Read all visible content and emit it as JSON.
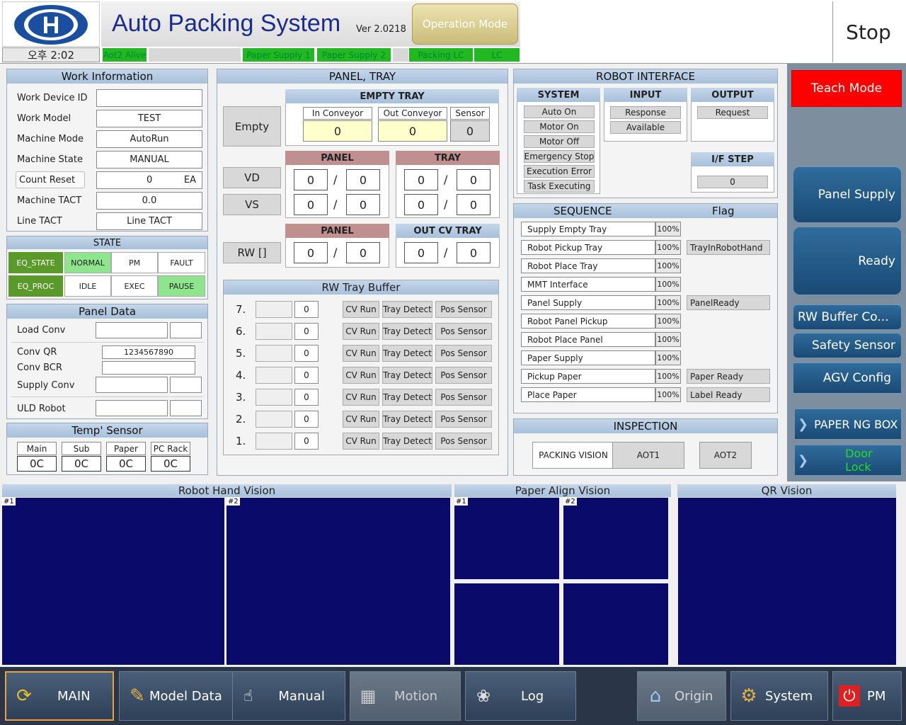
{
  "header": {
    "clock": "오후 2:02",
    "title": "Auto Packing System",
    "version": "Ver 2.0218",
    "operation_mode": "Operation Mode",
    "stop": "Stop",
    "status": [
      {
        "label": "Aot2 Alive"
      },
      {
        "label": ""
      },
      {
        "label": "Paper Supply 1"
      },
      {
        "label": "Paper Supply 2"
      },
      {
        "label": ""
      },
      {
        "label": "Packing LC"
      },
      {
        "label": "LC"
      }
    ]
  },
  "work_info": {
    "title": "Work Information",
    "rows": [
      {
        "label": "Work Device ID",
        "value": "",
        "unit": ""
      },
      {
        "label": "Work Model",
        "value": "TEST",
        "unit": ""
      },
      {
        "label": "Machine Mode",
        "value": "AutoRun",
        "unit": ""
      },
      {
        "label": "Machine State",
        "value": "MANUAL",
        "unit": ""
      },
      {
        "label": "Count Reset",
        "value": "0",
        "unit": "EA"
      },
      {
        "label": "Machine TACT",
        "value": "0.0",
        "unit": ""
      },
      {
        "label": "Line TACT",
        "value": "Line TACT",
        "unit": ""
      }
    ]
  },
  "state": {
    "title": "STATE",
    "eq_state": "EQ_STATE",
    "eq_proc": "EQ_PROC",
    "normal": "NORMAL",
    "pm": "PM",
    "fault": "FAULT",
    "idle": "IDLE",
    "exec": "EXEC",
    "pause": "PAUSE"
  },
  "panel_data": {
    "title": "Panel Data",
    "load_conv": "Load Conv",
    "conv_qr": "Conv QR",
    "conv_qr_value": "1234567890",
    "conv_bcr": "Conv BCR",
    "supply_conv": "Supply Conv",
    "uld_robot": "ULD Robot"
  },
  "temp": {
    "title": "Temp' Sensor",
    "items": [
      {
        "label": "Main",
        "value": "0C"
      },
      {
        "label": "Sub",
        "value": "0C"
      },
      {
        "label": "Paper",
        "value": "0C"
      },
      {
        "label": "PC Rack",
        "value": "0C"
      }
    ]
  },
  "panel_tray": {
    "title": "PANEL, TRAY",
    "empty_btn": "Empty",
    "empty_tray": "EMPTY TRAY",
    "in_conv": "In Conveyor",
    "out_conv": "Out Conveyor",
    "sensor": "Sensor",
    "in_val": "0",
    "out_val": "0",
    "sensor_val": "0",
    "panel": "PANEL",
    "tray": "TRAY",
    "out_cv_tray": "OUT CV TRAY",
    "vd": "VD",
    "vs": "VS",
    "rw": "RW []",
    "zero": "0",
    "slash": "/"
  },
  "rw_buffer": {
    "title": "RW Tray Buffer",
    "cv_run": "CV Run",
    "tray_detect": "Tray Detect",
    "pos_sensor": "Pos Sensor",
    "rows": [
      {
        "n": "7.",
        "v": "0"
      },
      {
        "n": "6.",
        "v": "0"
      },
      {
        "n": "5.",
        "v": "0"
      },
      {
        "n": "4.",
        "v": "0"
      },
      {
        "n": "3.",
        "v": "0"
      },
      {
        "n": "2.",
        "v": "0"
      },
      {
        "n": "1.",
        "v": "0"
      }
    ]
  },
  "robot_if": {
    "title": "ROBOT INTERFACE",
    "system": "SYSTEM",
    "input": "INPUT",
    "output": "OUTPUT",
    "system_items": [
      "Auto On",
      "Motor On",
      "Motor Off",
      "Emergency Stop",
      "Execution Error",
      "Task Executing"
    ],
    "input_items": [
      "Response",
      "Available"
    ],
    "output_items": [
      "Request"
    ],
    "if_step": "I/F STEP",
    "if_step_val": "0"
  },
  "sequence": {
    "title": "SEQUENCE",
    "flag": "Flag",
    "rows": [
      {
        "name": "Supply Empty Tray",
        "pct": "100%",
        "flag": ""
      },
      {
        "name": "Robot Pickup Tray",
        "pct": "100%",
        "flag": "TrayInRobotHand"
      },
      {
        "name": "Robot Place Tray",
        "pct": "100%",
        "flag": ""
      },
      {
        "name": "MMT Interface",
        "pct": "100%",
        "flag": ""
      },
      {
        "name": "Panel Supply",
        "pct": "100%",
        "flag": "PanelReady"
      },
      {
        "name": "Robot Panel Pickup",
        "pct": "100%",
        "flag": ""
      },
      {
        "name": "Robot Place Panel",
        "pct": "100%",
        "flag": ""
      },
      {
        "name": "Paper Supply",
        "pct": "100%",
        "flag": ""
      },
      {
        "name": "Pickup Paper",
        "pct": "100%",
        "flag": "Paper Ready"
      },
      {
        "name": "Place Paper",
        "pct": "100%",
        "flag": "Label Ready"
      }
    ]
  },
  "inspection": {
    "title": "INSPECTION",
    "packing_vision": "PACKING VISION",
    "aot1": "AOT1",
    "aot2": "AOT2"
  },
  "side": {
    "teach_mode": "Teach Mode",
    "panel_supply": "Panel Supply",
    "ready": "Ready",
    "rw_buffer": "RW Buffer Co...",
    "safety_sensor": "Safety Sensor",
    "agv_config": "AGV Config",
    "paper_ng_box": "PAPER NG BOX",
    "door_lock": "Door Lock"
  },
  "vision": {
    "robot_hand": "Robot Hand Vision",
    "paper_align": "Paper Align Vision",
    "qr": "QR Vision",
    "t1": "#1",
    "t2": "#2"
  },
  "nav": {
    "main": "MAIN",
    "model_data": "Model Data",
    "manual": "Manual",
    "motion": "Motion",
    "log": "Log",
    "origin": "Origin",
    "system": "System",
    "pm": "PM"
  },
  "colors": {
    "accent_green": "#22b822",
    "vision_bg": "#0a0a6a",
    "teach_red": "#ff0000"
  }
}
